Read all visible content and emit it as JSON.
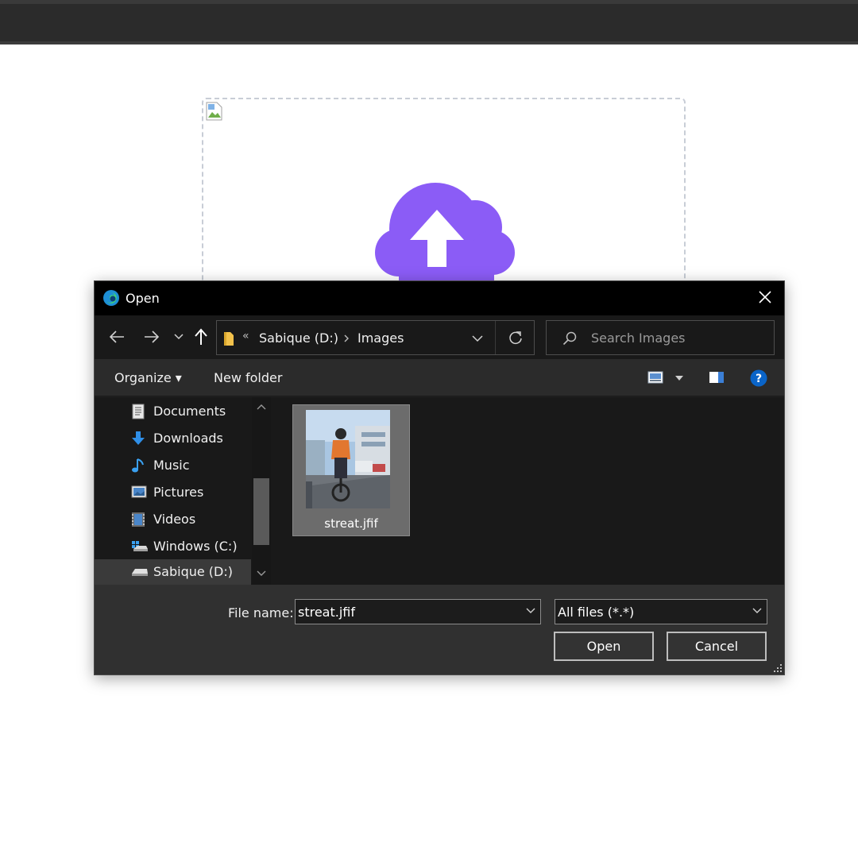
{
  "dialog": {
    "title": "Open",
    "breadcrumb": {
      "prefix": "«",
      "drive": "Sabique (D:)",
      "folder": "Images"
    },
    "search_placeholder": "Search Images",
    "toolbar": {
      "organize": "Organize ▾",
      "new_folder": "New folder"
    },
    "sidebar": {
      "items": [
        {
          "label": "Documents",
          "icon": "documents-icon"
        },
        {
          "label": "Downloads",
          "icon": "downloads-icon"
        },
        {
          "label": "Music",
          "icon": "music-icon"
        },
        {
          "label": "Pictures",
          "icon": "pictures-icon"
        },
        {
          "label": "Videos",
          "icon": "videos-icon"
        },
        {
          "label": "Windows (C:)",
          "icon": "windows-drive-icon"
        },
        {
          "label": "Sabique (D:)",
          "icon": "drive-icon",
          "selected": true
        }
      ]
    },
    "files": [
      {
        "name": "streat.jfif"
      }
    ],
    "footer": {
      "file_name_label": "File name:",
      "file_name_value": "streat.jfif",
      "file_type": "All files (*.*)",
      "open_label": "Open",
      "cancel_label": "Cancel"
    }
  },
  "colors": {
    "cloud": "#8b5cf6",
    "titlebar": "#000000",
    "help": "#0a64c8"
  }
}
